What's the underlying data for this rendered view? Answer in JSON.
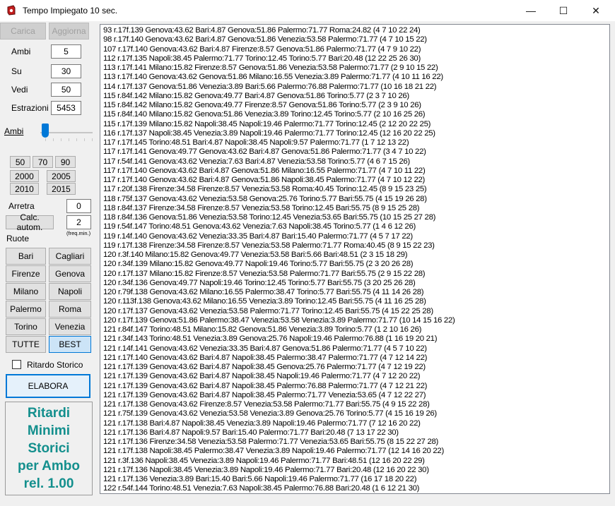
{
  "window": {
    "title": "Tempo Impiegato 10 sec.",
    "controls": [
      "—",
      "☐",
      "✕"
    ]
  },
  "left": {
    "carica": "Carica",
    "aggiorna": "Aggiorna",
    "ambi_label": "Ambi",
    "ambi_value": "5",
    "su_label": "Su",
    "su_value": "30",
    "vedi_label": "Vedi",
    "vedi_value": "50",
    "estrazioni_label": "Estrazioni",
    "estrazioni_value": "5453",
    "slider_label": "Ambi",
    "years": [
      "50",
      "70",
      "90",
      "2000",
      "2005",
      "2010",
      "2015"
    ],
    "arretra_label": "Arretra",
    "arretra_value": "0",
    "calc_label": "Calc. autom.",
    "calc_value": "2",
    "freq_label": "(freq.min.)",
    "ruote_label": "Ruote",
    "ruote": [
      "Bari",
      "Cagliari",
      "Firenze",
      "Genova",
      "Milano",
      "Napoli",
      "Palermo",
      "Roma",
      "Torino",
      "Venezia"
    ],
    "tutte": "TUTTE",
    "best": "BEST",
    "ritardo_label": "Ritardo Storico",
    "elabora": "ELABORA",
    "logo_lines": [
      "Ritardi",
      "Minimi",
      "Storici",
      "per Ambo",
      "rel. 1.00"
    ]
  },
  "results": [
    "93 r.17f.139 Genova:43.62 Bari:4.87 Genova:51.86 Palermo:71.77 Roma:24.82 (4 7 10 22 24)",
    "98 r.17f.140 Genova:43.62 Bari:4.87 Genova:51.86 Venezia:53.58 Palermo:71.77 (4 7 10 15 22)",
    "107 r.17f.140 Genova:43.62 Bari:4.87 Firenze:8.57 Genova:51.86 Palermo:71.77 (4 7 9 10 22)",
    "112 r.17f.135 Napoli:38.45 Palermo:71.77 Torino:12.45 Torino:5.77 Bari:20.48 (12 22 25 26 30)",
    "113 r.17f.141 Milano:15.82 Firenze:8.57 Genova:51.86 Venezia:53.58 Palermo:71.77 (2 9 10 15 22)",
    "113 r.17f.140 Genova:43.62 Genova:51.86 Milano:16.55 Venezia:3.89 Palermo:71.77 (4 10 11 16 22)",
    "114 r.17f.137 Genova:51.86 Venezia:3.89 Bari:5.66 Palermo:76.88 Palermo:71.77 (10 16 18 21 22)",
    "115 r.84f.142 Milano:15.82 Genova:49.77 Bari:4.87 Genova:51.86 Torino:5.77 (2 3 7 10 26)",
    "115 r.84f.142 Milano:15.82 Genova:49.77 Firenze:8.57 Genova:51.86 Torino:5.77 (2 3 9 10 26)",
    "115 r.84f.140 Milano:15.82 Genova:51.86 Venezia:3.89 Torino:12.45 Torino:5.77 (2 10 16 25 26)",
    "115 r.17f.139 Milano:15.82 Napoli:38.45 Napoli:19.46 Palermo:71.77 Torino:12.45 (2 12 20 22 25)",
    "116 r.17f.137 Napoli:38.45 Venezia:3.89 Napoli:19.46 Palermo:71.77 Torino:12.45 (12 16 20 22 25)",
    "117 r.17f.145 Torino:48.51 Bari:4.87 Napoli:38.45 Napoli:9.57 Palermo:71.77 (1 7 12 13 22)",
    "117 r.17f.141 Genova:49.77 Genova:43.62 Bari:4.87 Genova:51.86 Palermo:71.77 (3 4 7 10 22)",
    "117 r.54f.141 Genova:43.62 Venezia:7.63 Bari:4.87 Venezia:53.58 Torino:5.77 (4 6 7 15 26)",
    "117 r.17f.140 Genova:43.62 Bari:4.87 Genova:51.86 Milano:16.55 Palermo:71.77 (4 7 10 11 22)",
    "117 r.17f.140 Genova:43.62 Bari:4.87 Genova:51.86 Napoli:38.45 Palermo:71.77 (4 7 10 12 22)",
    "117 r.20f.138 Firenze:34.58 Firenze:8.57 Venezia:53.58 Roma:40.45 Torino:12.45 (8 9 15 23 25)",
    "118 r.75f.137 Genova:43.62 Venezia:53.58 Genova:25.76 Torino:5.77 Bari:55.75 (4 15 19 26 28)",
    "118 r.84f.137 Firenze:34.58 Firenze:8.57 Venezia:53.58 Torino:12.45 Bari:55.75 (8 9 15 25 28)",
    "118 r.84f.136 Genova:51.86 Venezia:53.58 Torino:12.45 Venezia:53.65 Bari:55.75 (10 15 25 27 28)",
    "119 r.54f.147 Torino:48.51 Genova:43.62 Venezia:7.63 Napoli:38.45 Torino:5.77 (1 4 6 12 26)",
    "119 r.14f.140 Genova:43.62 Venezia:33.35 Bari:4.87 Bari:15.40 Palermo:71.77 (4 5 7 17 22)",
    "119 r.17f.138 Firenze:34.58 Firenze:8.57 Venezia:53.58 Palermo:71.77 Roma:40.45 (8 9 15 22 23)",
    "120 r.3f.140 Milano:15.82 Genova:49.77 Venezia:53.58 Bari:5.66 Bari:48.51 (2 3 15 18 29)",
    "120 r.34f.139 Milano:15.82 Genova:49.77 Napoli:19.46 Torino:5.77 Bari:55.75 (2 3 20 26 28)",
    "120 r.17f.137 Milano:15.82 Firenze:8.57 Venezia:53.58 Palermo:71.77 Bari:55.75 (2 9 15 22 28)",
    "120 r.34f.136 Genova:49.77 Napoli:19.46 Torino:12.45 Torino:5.77 Bari:55.75 (3 20 25 26 28)",
    "120 r.79f.138 Genova:43.62 Milano:16.55 Palermo:38.47 Torino:5.77 Bari:55.75 (4 11 14 26 28)",
    "120 r.113f.138 Genova:43.62 Milano:16.55 Venezia:3.89 Torino:12.45 Bari:55.75 (4 11 16 25 28)",
    "120 r.17f.137 Genova:43.62 Venezia:53.58 Palermo:71.77 Torino:12.45 Bari:55.75 (4 15 22 25 28)",
    "120 r.17f.139 Genova:51.86 Palermo:38.47 Venezia:53.58 Venezia:3.89 Palermo:71.77 (10 14 15 16 22)",
    "121 r.84f.147 Torino:48.51 Milano:15.82 Genova:51.86 Venezia:3.89 Torino:5.77 (1 2 10 16 26)",
    "121 r.34f.143 Torino:48.51 Venezia:3.89 Genova:25.76 Napoli:19.46 Palermo:76.88 (1 16 19 20 21)",
    "121 r.14f.141 Genova:43.62 Venezia:33.35 Bari:4.87 Genova:51.86 Palermo:71.77 (4 5 7 10 22)",
    "121 r.17f.140 Genova:43.62 Bari:4.87 Napoli:38.45 Palermo:38.47 Palermo:71.77 (4 7 12 14 22)",
    "121 r.17f.139 Genova:43.62 Bari:4.87 Napoli:38.45 Genova:25.76 Palermo:71.77 (4 7 12 19 22)",
    "121 r.17f.139 Genova:43.62 Bari:4.87 Napoli:38.45 Napoli:19.46 Palermo:71.77 (4 7 12 20 22)",
    "121 r.17f.139 Genova:43.62 Bari:4.87 Napoli:38.45 Palermo:76.88 Palermo:71.77 (4 7 12 21 22)",
    "121 r.17f.139 Genova:43.62 Bari:4.87 Napoli:38.45 Palermo:71.77 Venezia:53.65 (4 7 12 22 27)",
    "121 r.17f.138 Genova:43.62 Firenze:8.57 Venezia:53.58 Palermo:71.77 Bari:55.75 (4 9 15 22 28)",
    "121 r.75f.139 Genova:43.62 Venezia:53.58 Venezia:3.89 Genova:25.76 Torino:5.77 (4 15 16 19 26)",
    "121 r.17f.138 Bari:4.87 Napoli:38.45 Venezia:3.89 Napoli:19.46 Palermo:71.77 (7 12 16 20 22)",
    "121 r.17f.136 Bari:4.87 Napoli:9.57 Bari:15.40 Palermo:71.77 Bari:20.48 (7 13 17 22 30)",
    "121 r.17f.136 Firenze:34.58 Venezia:53.58 Palermo:71.77 Venezia:53.65 Bari:55.75 (8 15 22 27 28)",
    "121 r.17f.138 Napoli:38.45 Palermo:38.47 Venezia:3.89 Napoli:19.46 Palermo:71.77 (12 14 16 20 22)",
    "121 r.3f.136 Napoli:38.45 Venezia:3.89 Napoli:19.46 Palermo:71.77 Bari:48.51 (12 16 20 22 29)",
    "121 r.17f.136 Napoli:38.45 Venezia:3.89 Napoli:19.46 Palermo:71.77 Bari:20.48 (12 16 20 22 30)",
    "121 r.17f.136 Venezia:3.89 Bari:15.40 Bari:5.66 Napoli:19.46 Palermo:71.77 (16 17 18 20 22)",
    "122 r.54f.144 Torino:48.51 Venezia:7.63 Napoli:38.45 Palermo:76.88 Bari:20.48 (1 6 12 21 30)"
  ]
}
